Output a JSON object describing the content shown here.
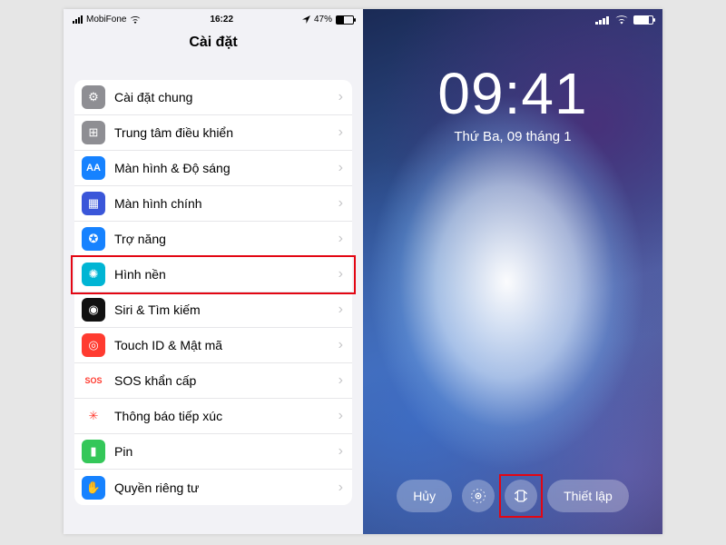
{
  "left": {
    "status": {
      "carrier": "MobiFone",
      "time": "16:22",
      "battery_pct": "47%"
    },
    "title": "Cài đặt",
    "items": [
      {
        "label": "Cài đặt chung",
        "icon": "gear-icon",
        "bg": "#8e8e93",
        "glyph": "⚙"
      },
      {
        "label": "Trung tâm điều khiển",
        "icon": "control-center-icon",
        "bg": "#8e8e93",
        "glyph": "⊞"
      },
      {
        "label": "Màn hình & Độ sáng",
        "icon": "display-icon",
        "bg": "#1682ff",
        "glyph": "AA"
      },
      {
        "label": "Màn hình chính",
        "icon": "home-screen-icon",
        "bg": "#3a56d9",
        "glyph": "▦"
      },
      {
        "label": "Trợ năng",
        "icon": "accessibility-icon",
        "bg": "#1682ff",
        "glyph": "✪"
      },
      {
        "label": "Hình nền",
        "icon": "wallpaper-icon",
        "bg": "#00b5d4",
        "glyph": "✺"
      },
      {
        "label": "Siri & Tìm kiếm",
        "icon": "siri-icon",
        "bg": "#111111",
        "glyph": "◉"
      },
      {
        "label": "Touch ID & Mật mã",
        "icon": "touch-id-icon",
        "bg": "#ff3b30",
        "glyph": "◎"
      },
      {
        "label": "SOS khẩn cấp",
        "icon": "sos-icon",
        "bg": "#ffffff",
        "glyph": "SOS",
        "fg": "#ff3b30"
      },
      {
        "label": "Thông báo tiếp xúc",
        "icon": "exposure-icon",
        "bg": "#ffffff",
        "glyph": "✳",
        "fg": "#ff3b30"
      },
      {
        "label": "Pin",
        "icon": "battery-icon",
        "bg": "#34c759",
        "glyph": "▮"
      },
      {
        "label": "Quyền riêng tư",
        "icon": "privacy-icon",
        "bg": "#1682ff",
        "glyph": "✋"
      }
    ],
    "highlight_index": 5
  },
  "right": {
    "clock": "09:41",
    "date": "Thứ Ba, 09 tháng 1",
    "dock": {
      "cancel": "Hủy",
      "set": "Thiết lập"
    },
    "highlight_button": "perspective"
  }
}
